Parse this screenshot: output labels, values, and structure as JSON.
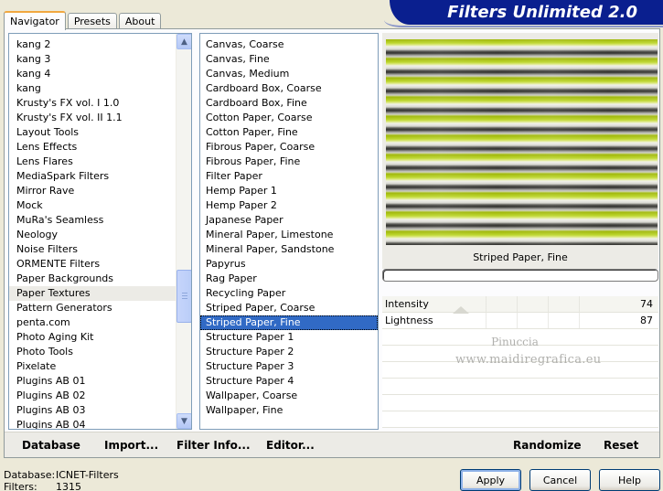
{
  "app_title": "Filters Unlimited 2.0",
  "tabs": [
    "Navigator",
    "Presets",
    "About"
  ],
  "categories": [
    "kang 2",
    "kang 3",
    "kang 4",
    "kang",
    "Krusty's FX vol. I 1.0",
    "Krusty's FX vol. II 1.1",
    "Layout Tools",
    "Lens Effects",
    "Lens Flares",
    "MediaSpark Filters",
    "Mirror Rave",
    "Mock",
    "MuRa's Seamless",
    "Neology",
    "Noise Filters",
    "ORMENTE Filters",
    "Paper Backgrounds",
    "Paper Textures",
    "Pattern Generators",
    "penta.com",
    "Photo Aging Kit",
    "Photo Tools",
    "Pixelate",
    "Plugins AB 01",
    "Plugins AB 02",
    "Plugins AB 03",
    "Plugins AB 04"
  ],
  "selected_category": "Paper Textures",
  "filters": [
    "Canvas, Coarse",
    "Canvas, Fine",
    "Canvas, Medium",
    "Cardboard Box, Coarse",
    "Cardboard Box, Fine",
    "Cotton Paper, Coarse",
    "Cotton Paper, Fine",
    "Fibrous Paper, Coarse",
    "Fibrous Paper, Fine",
    "Filter Paper",
    "Hemp Paper 1",
    "Hemp Paper 2",
    "Japanese Paper",
    "Mineral Paper, Limestone",
    "Mineral Paper, Sandstone",
    "Papyrus",
    "Rag Paper",
    "Recycling Paper",
    "Striped Paper, Coarse",
    "Striped Paper, Fine",
    "Structure Paper 1",
    "Structure Paper 2",
    "Structure Paper 3",
    "Structure Paper 4",
    "Wallpaper, Coarse",
    "Wallpaper, Fine"
  ],
  "selected_filter": "Striped Paper, Fine",
  "preview_label": "Striped Paper, Fine",
  "params": [
    {
      "name": "Intensity",
      "value": "74"
    },
    {
      "name": "Lightness",
      "value": "87"
    }
  ],
  "watermark": {
    "line1": "Pinuccia",
    "line2": "www.maidiregrafica.eu"
  },
  "toolbar": {
    "database": "Database",
    "import": "Import...",
    "filter_info": "Filter Info...",
    "editor": "Editor...",
    "randomize": "Randomize",
    "reset": "Reset"
  },
  "status": {
    "database_label": "Database:",
    "database_value": "ICNET-Filters",
    "filters_label": "Filters:",
    "filters_value": "1315"
  },
  "buttons": {
    "apply": "Apply",
    "cancel": "Cancel",
    "help": "Help"
  },
  "colors": {
    "banner": "#0a1f8f",
    "selection": "#316ac5",
    "accent_tab": "#f1a840"
  }
}
